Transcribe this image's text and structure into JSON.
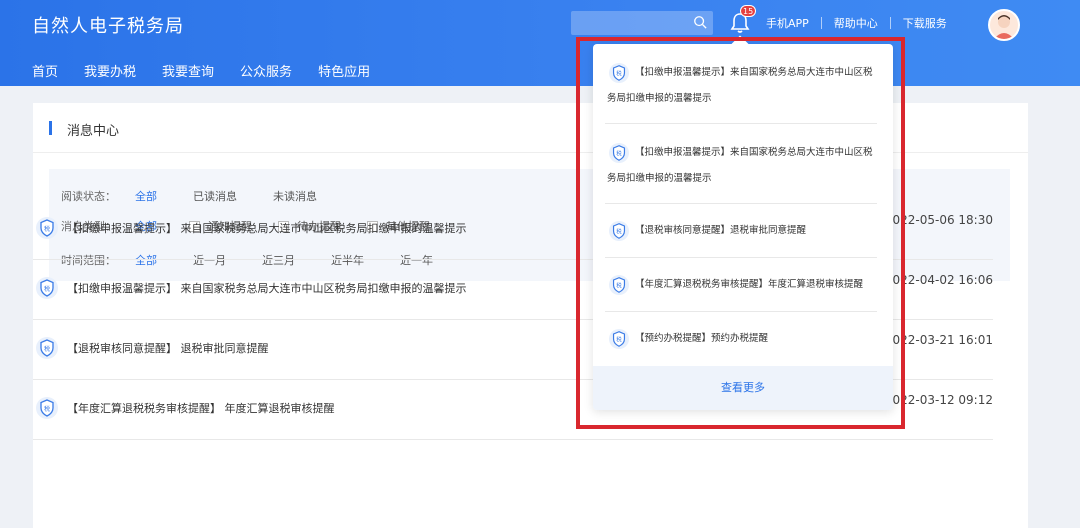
{
  "header": {
    "title": "自然人电子税务局",
    "nav": [
      "首页",
      "我要办税",
      "我要查询",
      "公众服务",
      "特色应用"
    ],
    "notification_count": "15",
    "links": [
      "手机APP",
      "帮助中心",
      "下载服务"
    ]
  },
  "panel": {
    "title": "消息中心",
    "filters": {
      "read_status": {
        "label": "阅读状态：",
        "options": [
          "全部",
          "已读消息",
          "未读消息"
        ]
      },
      "msg_type": {
        "label": "消息类型：",
        "all": "全部",
        "checkboxes": [
          "通知提醒",
          "待办提醒",
          "其他提醒"
        ]
      },
      "time_range": {
        "label": "时间范围：",
        "options": [
          "全部",
          "近一月",
          "近三月",
          "近半年",
          "近一年"
        ]
      }
    },
    "messages": [
      {
        "text": "【扣缴申报温馨提示】 来自国家税务总局大连市中山区税务局扣缴申报的温馨提示",
        "time": "2022-05-06 18:30"
      },
      {
        "text": "【扣缴申报温馨提示】 来自国家税务总局大连市中山区税务局扣缴申报的温馨提示",
        "time": "2022-04-02 16:06"
      },
      {
        "text": "【退税审核同意提醒】 退税审批同意提醒",
        "time": "2022-03-21 16:01"
      },
      {
        "text": "【年度汇算退税税务审核提醒】 年度汇算退税审核提醒",
        "time": "2022-03-12 09:12"
      }
    ]
  },
  "dropdown": {
    "items": [
      "【扣缴申报温馨提示】来自国家税务总局大连市中山区税务局扣缴申报的温馨提示",
      "【扣缴申报温馨提示】来自国家税务总局大连市中山区税务局扣缴申报的温馨提示",
      "【退税审核同意提醒】退税审批同意提醒",
      "【年度汇算退税税务审核提醒】年度汇算退税审核提醒",
      "【预约办税提醒】预约办税提醒"
    ],
    "more": "查看更多"
  },
  "colors": {
    "primary": "#2b73e8",
    "highlight": "#d9272e"
  }
}
